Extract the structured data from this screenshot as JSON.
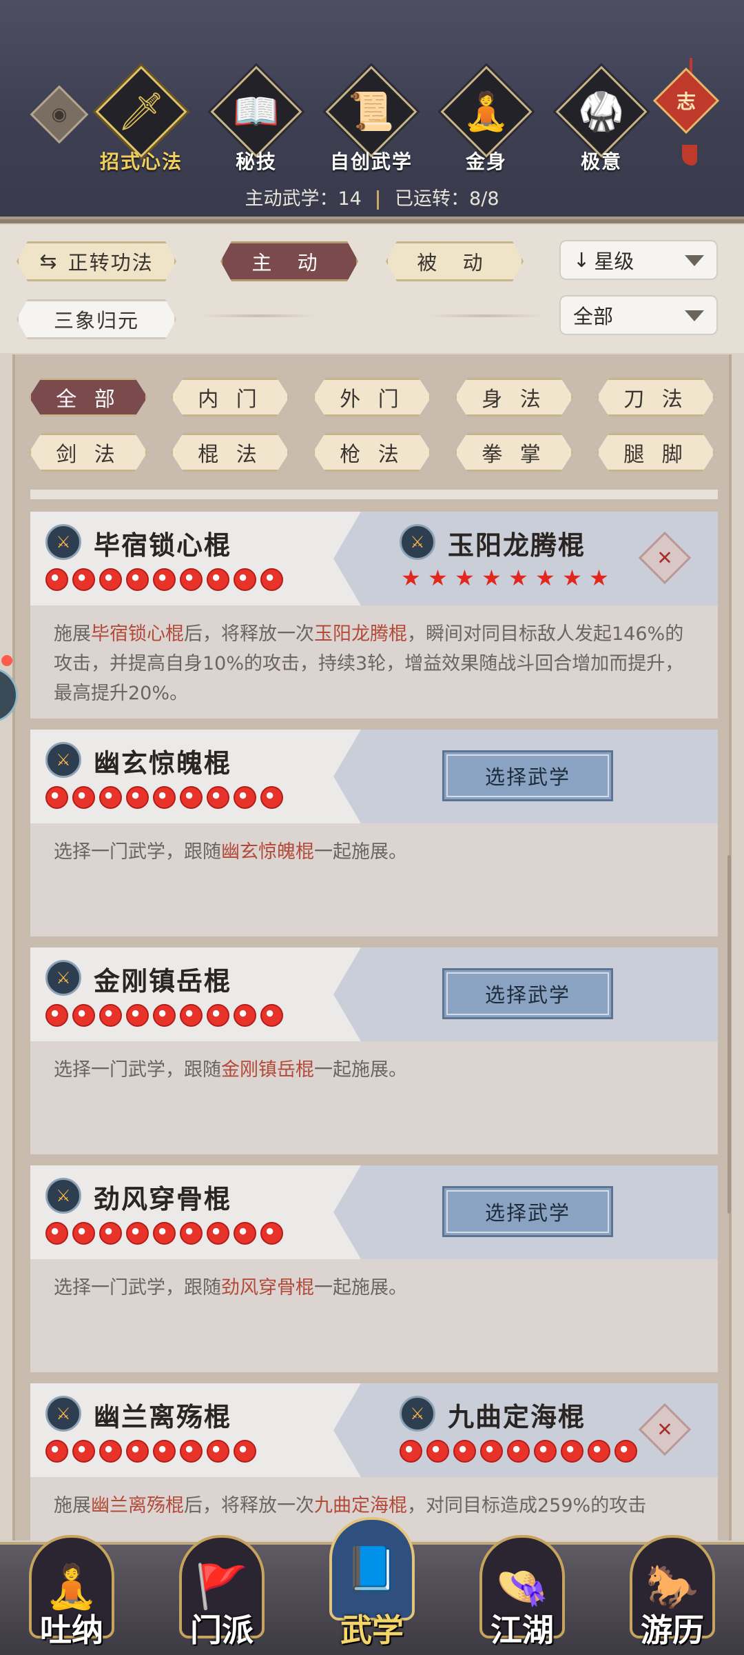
{
  "header": {
    "tabs": [
      {
        "label": "招式心法",
        "icon": "sword-icon",
        "glyph": "🗡",
        "active": true
      },
      {
        "label": "秘技",
        "icon": "book-icon",
        "glyph": "📖",
        "active": false
      },
      {
        "label": "自创武学",
        "icon": "scroll-icon",
        "glyph": "📜",
        "active": false
      },
      {
        "label": "金身",
        "icon": "meditation-icon",
        "glyph": "🧘",
        "active": false
      },
      {
        "label": "极意",
        "icon": "martial-stance-icon",
        "glyph": "🥋",
        "active": false
      }
    ],
    "knot_glyph": "志",
    "active_label": "主动武学：14",
    "running_label": "已运转：8/8"
  },
  "filters": {
    "cycle_button": "正转功法",
    "active_button": "主 动",
    "passive_button": "被 动",
    "sort_select": "星级",
    "unify_button": "三象归元",
    "scope_select": "全部"
  },
  "categories": [
    "全 部",
    "内 门",
    "外 门",
    "身 法",
    "刀 法",
    "剑 法",
    "棍 法",
    "枪 法",
    "拳 掌",
    "腿 脚"
  ],
  "cards": [
    {
      "primary": "毕宿锁心棍",
      "secondary": "玉阳龙腾棍",
      "primary_stars": 9,
      "secondary_stars": 8,
      "desc_parts": [
        "施展",
        "毕宿锁心棍",
        "后，将释放一次",
        "玉阳龙腾棍",
        "，瞬间对同目标敌人发起146%的攻击，并提高自身10%的攻击，持续3轮，增益效果随战斗回合增加而提升，最高提升20%。"
      ]
    },
    {
      "primary": "幽玄惊魄棍",
      "button": "选择武学",
      "primary_stars": 9,
      "desc_parts": [
        "选择一门武学，跟随",
        "幽玄惊魄棍",
        "一起施展。"
      ]
    },
    {
      "primary": "金刚镇岳棍",
      "button": "选择武学",
      "primary_stars": 9,
      "desc_parts": [
        "选择一门武学，跟随",
        "金刚镇岳棍",
        "一起施展。"
      ]
    },
    {
      "primary": "劲风穿骨棍",
      "button": "选择武学",
      "primary_stars": 9,
      "desc_parts": [
        "选择一门武学，跟随",
        "劲风穿骨棍",
        "一起施展。"
      ]
    },
    {
      "primary": "幽兰离殇棍",
      "secondary": "九曲定海棍",
      "primary_stars": 8,
      "secondary_stars": 9,
      "desc_parts": [
        "施展",
        "幽兰离殇棍",
        "后，将释放一次",
        "九曲定海棍",
        "，对同目标造成259%的攻击"
      ]
    }
  ],
  "bottom_nav": [
    {
      "label": "吐纳",
      "icon": "monk-icon",
      "glyph": "🧘",
      "active": false
    },
    {
      "label": "门派",
      "icon": "sect-flags-icon",
      "glyph": "🚩",
      "active": false
    },
    {
      "label": "武学",
      "icon": "martial-books-icon",
      "glyph": "📘",
      "active": true
    },
    {
      "label": "江湖",
      "icon": "straw-hat-icon",
      "glyph": "👒",
      "active": false
    },
    {
      "label": "游历",
      "icon": "horse-icon",
      "glyph": "🐎",
      "active": false
    }
  ],
  "colors": {
    "accent_gold": "#e4c257",
    "active_pill": "#7a4a4c",
    "highlight_text": "#b24a3a",
    "star_red": "#e7332a"
  }
}
